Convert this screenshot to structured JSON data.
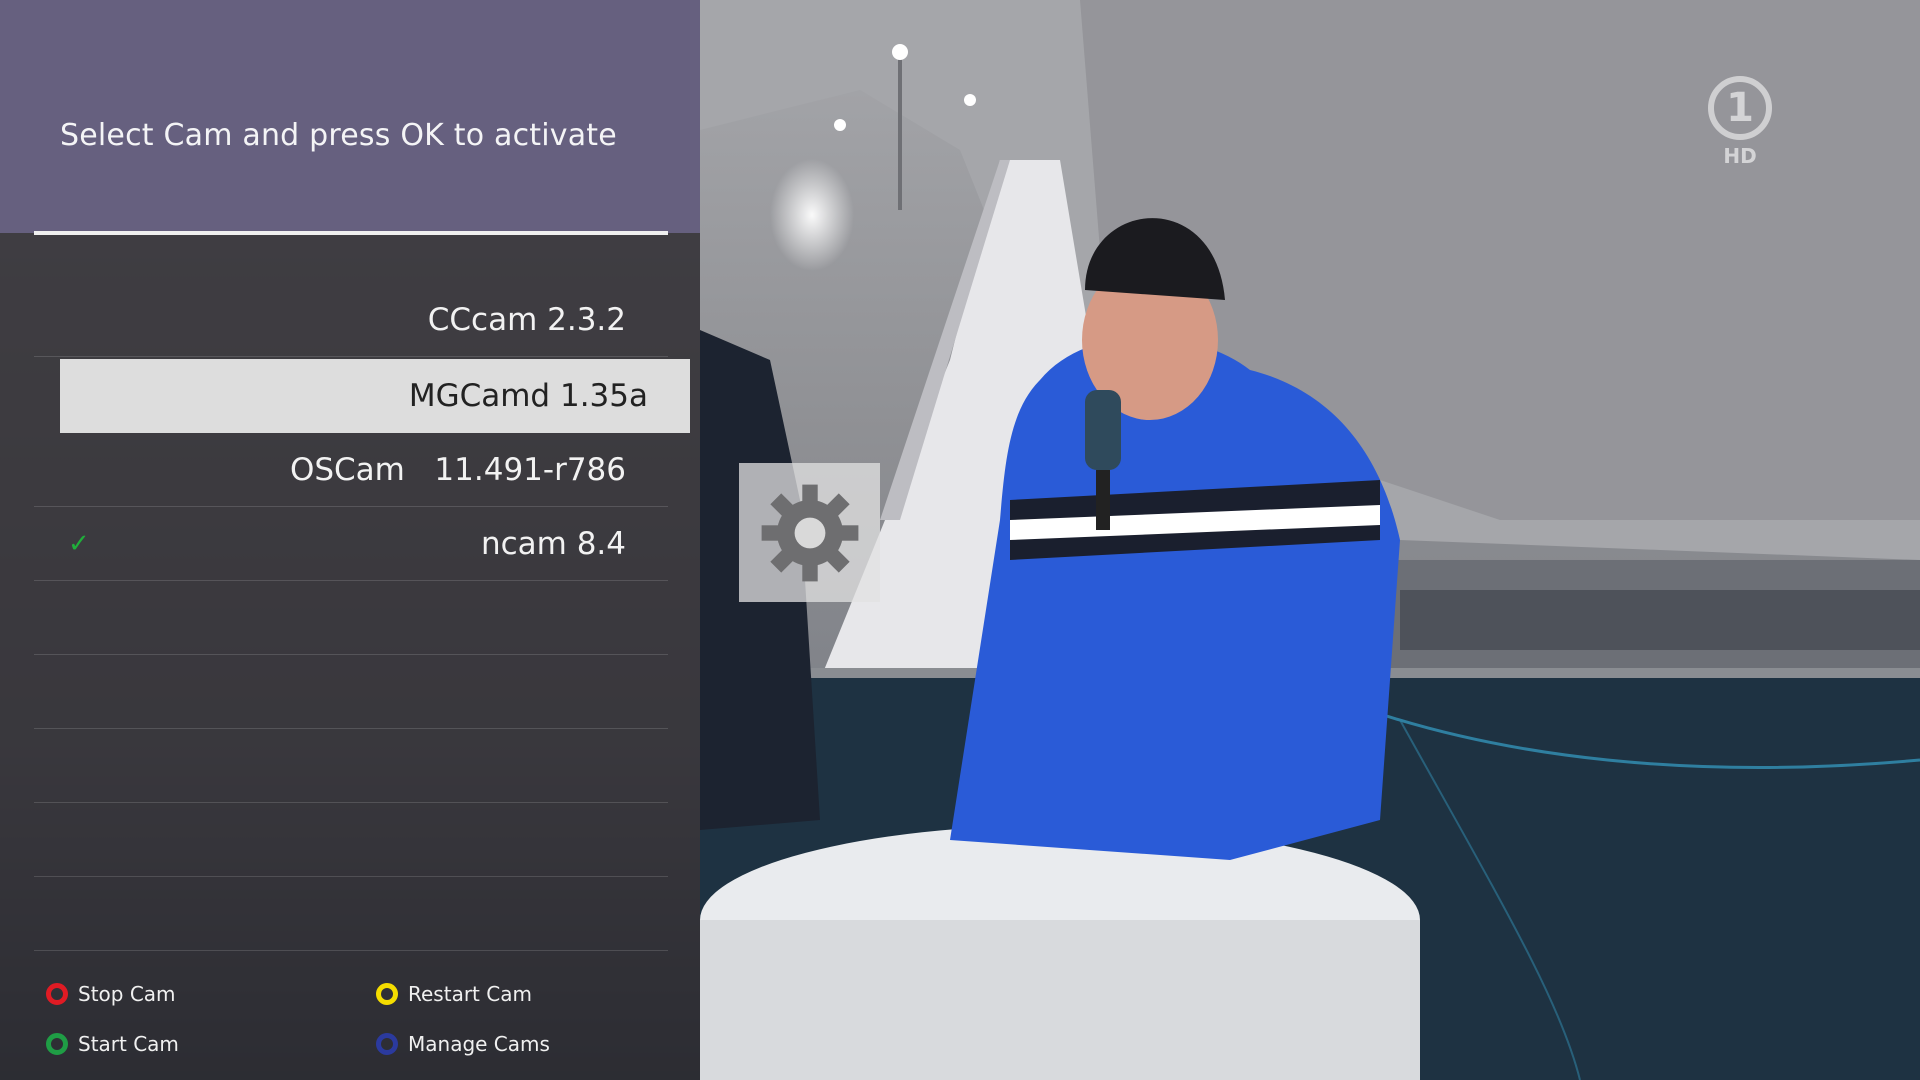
{
  "title": "Select Cam and press OK to activate",
  "channel_logo": {
    "symbol": "1",
    "badge": "HD"
  },
  "cams": [
    {
      "label": "CCcam 2.3.2",
      "selected": false,
      "active": false
    },
    {
      "label": "MGCamd 1.35a",
      "selected": true,
      "active": false
    },
    {
      "label": "OSCam   11.491-r786",
      "selected": false,
      "active": false
    },
    {
      "label": "ncam 8.4",
      "selected": false,
      "active": true
    }
  ],
  "active_mark": "✓",
  "keys": {
    "red": {
      "label": "Stop Cam",
      "color": "#e01b24"
    },
    "green": {
      "label": "Start Cam",
      "color": "#1f9d45"
    },
    "yellow": {
      "label": "Restart Cam",
      "color": "#f5dd00"
    },
    "blue": {
      "label": "Manage Cams",
      "color": "#2b3a9e"
    }
  },
  "colors": {
    "header": "#66607f",
    "selected_row": "#dddddd",
    "check": "#1fae3a"
  }
}
